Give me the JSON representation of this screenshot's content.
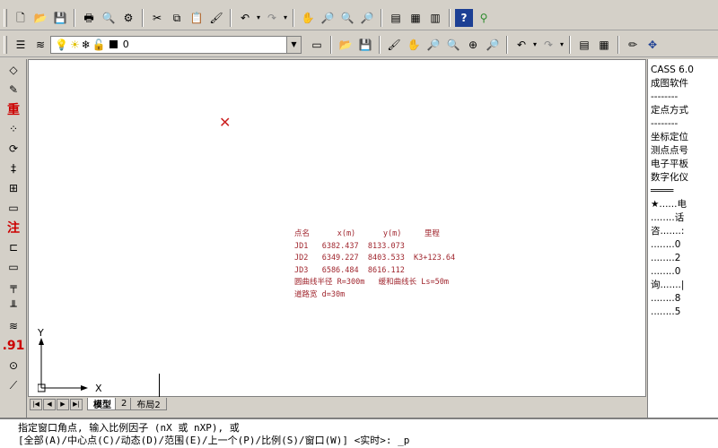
{
  "toolbar1": {
    "icons": [
      "new-icon",
      "open-icon",
      "save-icon",
      "print-icon",
      "preview-icon",
      "plot-icon",
      "cut-icon",
      "copy-icon",
      "paste-icon",
      "matchprop-icon",
      "undo-icon",
      "redo-icon",
      "pan-icon",
      "zoom-realtime-icon",
      "zoom-window-icon",
      "zoom-previous-icon",
      "properties-icon",
      "design-center-icon",
      "tool-palette-icon",
      "help-icon",
      "link-icon"
    ]
  },
  "toolbar2": {
    "layer_value": "0",
    "layer_swatch_color": "#000000"
  },
  "left_toolbar": {
    "buttons": [
      {
        "glyph": "◇",
        "name": "point-icon"
      },
      {
        "glyph": "✎",
        "name": "edit-icon"
      },
      {
        "glyph": "重",
        "name": "redraw-icon",
        "red": true
      },
      {
        "glyph": "⁘",
        "name": "grid-points-icon"
      },
      {
        "glyph": "⟳",
        "name": "rotate-icon"
      },
      {
        "glyph": "‡",
        "name": "dimension-icon"
      },
      {
        "glyph": "⊞",
        "name": "hatch-icon"
      },
      {
        "glyph": "▭",
        "name": "scale-bar-icon"
      },
      {
        "glyph": "注",
        "name": "annotation-icon",
        "red": true
      },
      {
        "glyph": "⊏",
        "name": "rectangle-icon"
      },
      {
        "glyph": "▭",
        "name": "box-icon"
      },
      {
        "glyph": "╤",
        "name": "wall-icon"
      },
      {
        "glyph": "╨",
        "name": "fence-icon"
      },
      {
        "glyph": "≋",
        "name": "pipeline-icon"
      },
      {
        "glyph": ".91",
        "name": "elevation-icon",
        "red": true
      },
      {
        "glyph": "⊙",
        "name": "control-point-icon"
      },
      {
        "glyph": "⟋",
        "name": "line-icon"
      }
    ]
  },
  "drawing": {
    "lines": [
      "点名      x(m)      y(m)     里程",
      "JD1   6382.437  8133.073",
      "JD2   6349.227  8403.533  K3+123.64",
      "JD3   6586.484  8616.112",
      "圆曲线半径 R=300m   缓和曲线长 Ls=50m",
      "道路宽 d=30m"
    ],
    "ucs_y": "Y",
    "ucs_x": "X"
  },
  "tabs": {
    "model": "模型",
    "layout1": "2",
    "layout2": "布局2"
  },
  "right_panel": {
    "items": [
      "CASS 6.0",
      "成图软件",
      "--------",
      "定点方式",
      "--------",
      "坐标定位",
      "测点点号",
      "电子平板",
      "数字化仪",
      "════",
      "★......电",
      "  ........话",
      "咨.......:",
      "  ........0",
      "  ........2",
      "  ........0",
      "询.......|",
      "  ........8",
      "  ........5"
    ]
  },
  "command": {
    "line1": "指定窗口角点, 输入比例因子 (nX 或 nXP), 或",
    "line2": "[全部(A)/中心点(C)/动态(D)/范围(E)/上一个(P)/比例(S)/窗口(W)] <实时>: _p"
  }
}
